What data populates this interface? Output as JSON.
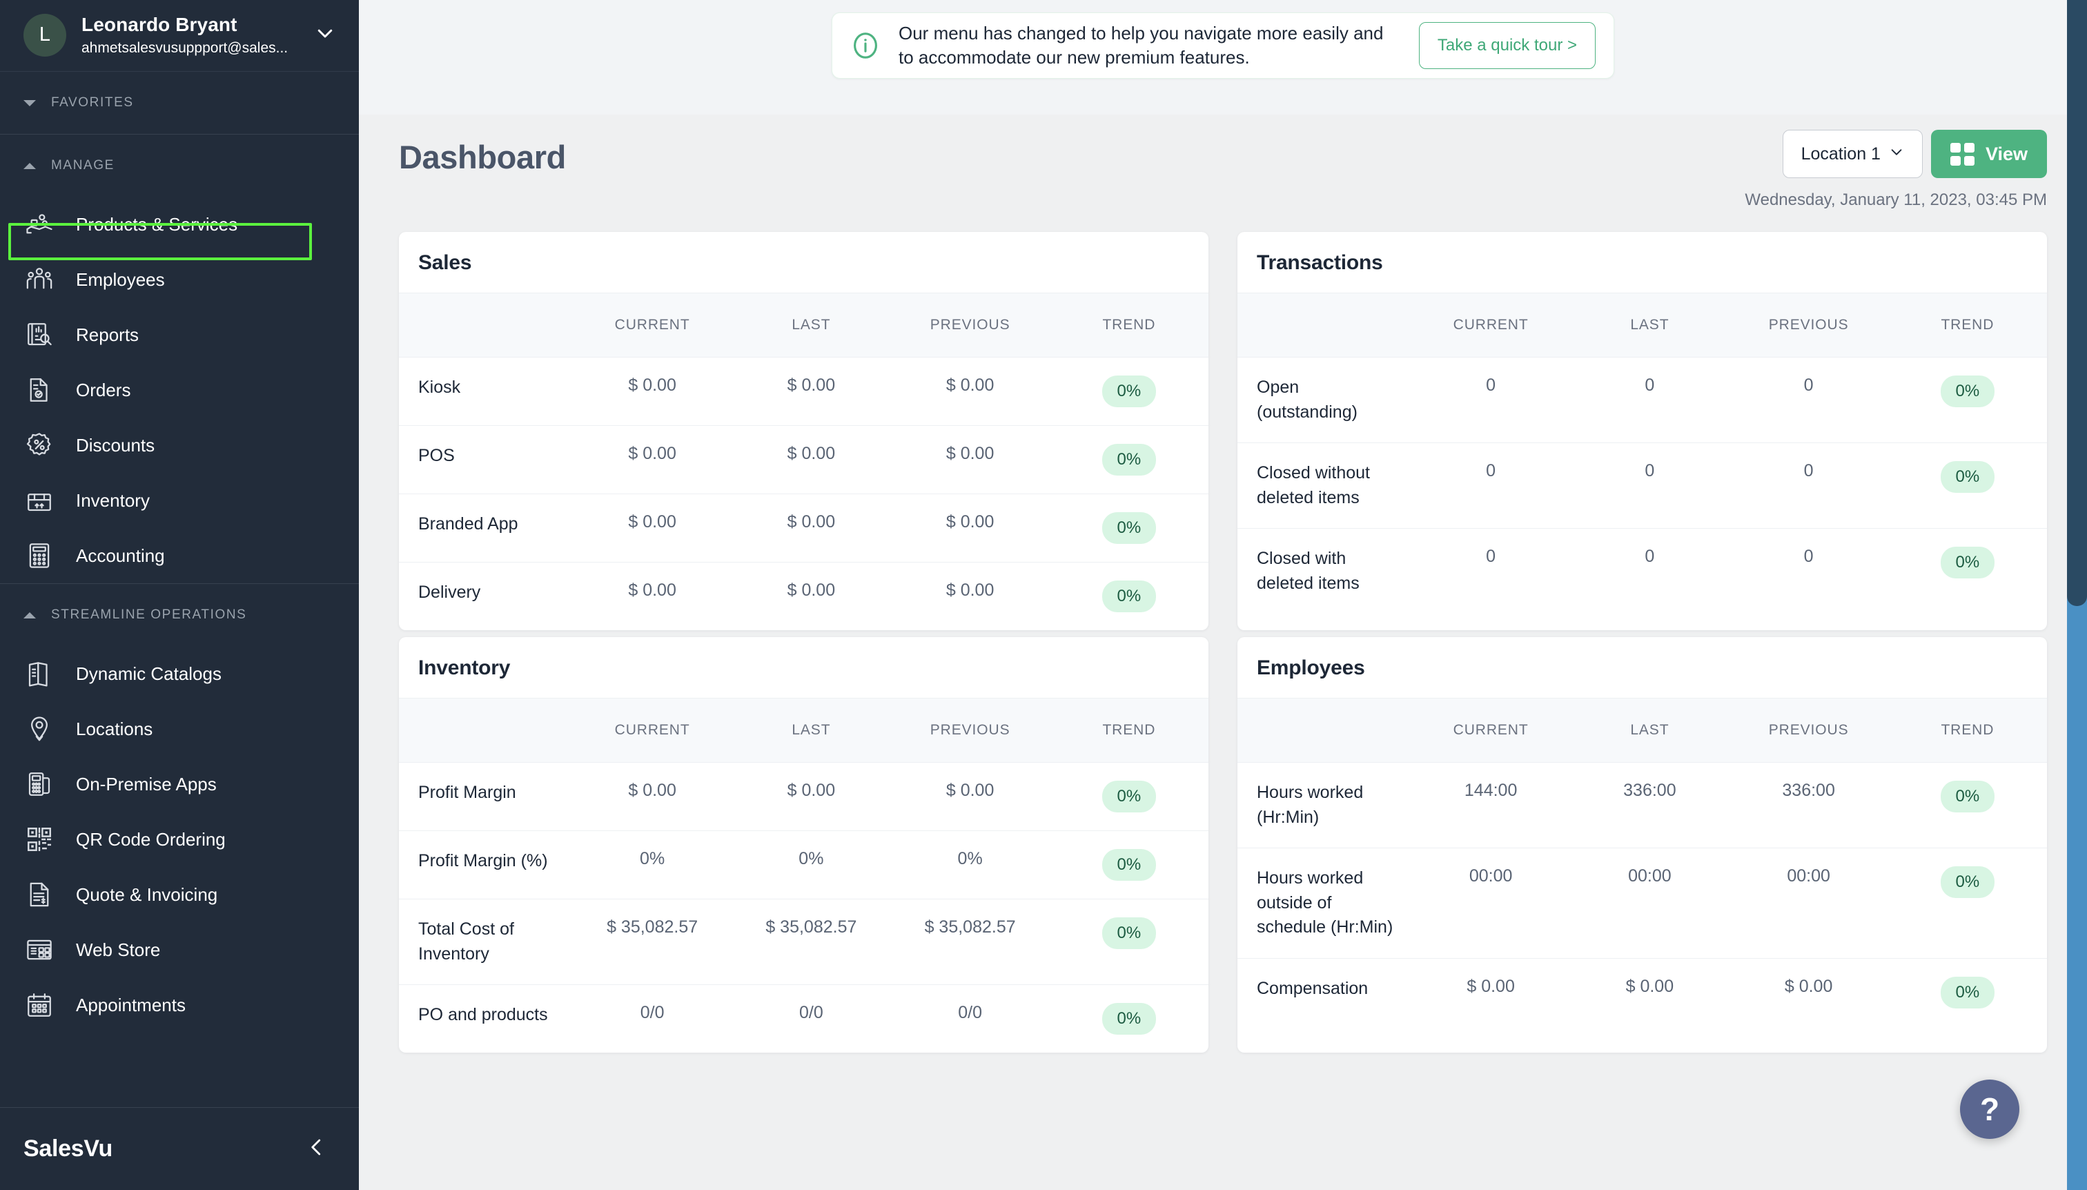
{
  "sidebar": {
    "profile": {
      "initial": "L",
      "name": "Leonardo Bryant",
      "email": "ahmetsalesvusuppport@sales...",
      "caret_icon": "chevron-down-icon"
    },
    "sections": [
      {
        "label": "FAVORITES",
        "state": "collapsed",
        "items": []
      },
      {
        "label": "MANAGE",
        "state": "expanded",
        "items": [
          {
            "label": "Products & Services",
            "icon": "hand-holding-products-icon",
            "highlighted": true
          },
          {
            "label": "Employees",
            "icon": "people-group-icon"
          },
          {
            "label": "Reports",
            "icon": "report-search-icon"
          },
          {
            "label": "Orders",
            "icon": "order-document-icon"
          },
          {
            "label": "Discounts",
            "icon": "percent-badge-icon"
          },
          {
            "label": "Inventory",
            "icon": "box-icon"
          },
          {
            "label": "Accounting",
            "icon": "calculator-icon"
          }
        ]
      },
      {
        "label": "STREAMLINE OPERATIONS",
        "state": "expanded",
        "items": [
          {
            "label": "Dynamic Catalogs",
            "icon": "catalog-book-icon"
          },
          {
            "label": "Locations",
            "icon": "map-pin-icon"
          },
          {
            "label": "On-Premise Apps",
            "icon": "pos-terminal-icon"
          },
          {
            "label": "QR Code Ordering",
            "icon": "qr-code-icon"
          },
          {
            "label": "Quote & Invoicing",
            "icon": "invoice-document-icon"
          },
          {
            "label": "Web Store",
            "icon": "web-store-icon"
          },
          {
            "label": "Appointments",
            "icon": "calendar-icon"
          }
        ]
      }
    ],
    "brand": "SalesVu",
    "collapse_icon": "chevron-left-icon",
    "highlight_color": "#5bf13e"
  },
  "banner": {
    "icon": "info-circle-icon",
    "message": "Our menu has changed to help you navigate more easily and to accommodate our new premium features.",
    "cta_label": "Take a quick tour >"
  },
  "header": {
    "title": "Dashboard",
    "location_label": "Location 1",
    "location_caret_icon": "chevron-down-icon",
    "view_label": "View",
    "view_icon": "grid-icon",
    "datetime": "Wednesday, January 11, 2023, 03:45 PM",
    "accent_color": "#4eb381"
  },
  "columns": [
    "CURRENT",
    "LAST",
    "PREVIOUS",
    "TREND"
  ],
  "cards": [
    {
      "title": "Sales",
      "rows": [
        {
          "label": "Kiosk",
          "current": "$ 0.00",
          "last": "$ 0.00",
          "previous": "$ 0.00",
          "trend": "0%"
        },
        {
          "label": "POS",
          "current": "$ 0.00",
          "last": "$ 0.00",
          "previous": "$ 0.00",
          "trend": "0%"
        },
        {
          "label": "Branded App",
          "current": "$ 0.00",
          "last": "$ 0.00",
          "previous": "$ 0.00",
          "trend": "0%"
        },
        {
          "label": "Delivery",
          "current": "$ 0.00",
          "last": "$ 0.00",
          "previous": "$ 0.00",
          "trend": "0%"
        }
      ]
    },
    {
      "title": "Transactions",
      "rows": [
        {
          "label": "Open (outstanding)",
          "current": "0",
          "last": "0",
          "previous": "0",
          "trend": "0%"
        },
        {
          "label": "Closed without deleted items",
          "current": "0",
          "last": "0",
          "previous": "0",
          "trend": "0%"
        },
        {
          "label": "Closed with deleted items",
          "current": "0",
          "last": "0",
          "previous": "0",
          "trend": "0%"
        }
      ]
    },
    {
      "title": "Inventory",
      "rows": [
        {
          "label": "Profit Margin",
          "current": "$ 0.00",
          "last": "$ 0.00",
          "previous": "$ 0.00",
          "trend": "0%"
        },
        {
          "label": "Profit Margin (%)",
          "current": "0%",
          "last": "0%",
          "previous": "0%",
          "trend": "0%"
        },
        {
          "label": "Total Cost of Inventory",
          "current": "$ 35,082.57",
          "last": "$ 35,082.57",
          "previous": "$ 35,082.57",
          "trend": "0%"
        },
        {
          "label": "PO and products",
          "current": "0/0",
          "last": "0/0",
          "previous": "0/0",
          "trend": "0%"
        }
      ]
    },
    {
      "title": "Employees",
      "rows": [
        {
          "label": "Hours worked (Hr:Min)",
          "current": "144:00",
          "last": "336:00",
          "previous": "336:00",
          "trend": "0%"
        },
        {
          "label": "Hours worked outside of schedule (Hr:Min)",
          "current": "00:00",
          "last": "00:00",
          "previous": "00:00",
          "trend": "0%"
        },
        {
          "label": "Compensation",
          "current": "$ 0.00",
          "last": "$ 0.00",
          "previous": "$ 0.00",
          "trend": "0%"
        }
      ]
    }
  ],
  "help": {
    "label": "?",
    "icon": "question-mark-icon"
  },
  "scrollbar": {
    "track_color": "#4a90c4",
    "thumb_color": "#2a4a63"
  }
}
